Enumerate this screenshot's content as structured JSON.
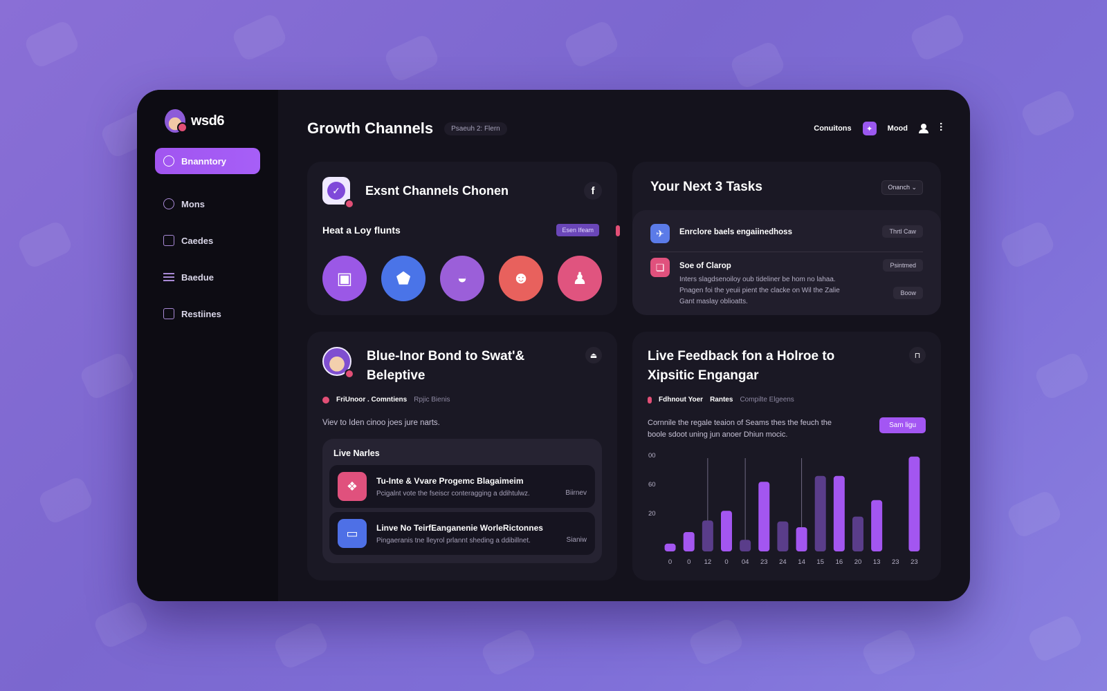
{
  "brand": {
    "name": "wsd6"
  },
  "sidebar": {
    "items": [
      {
        "label": "Bnanntory",
        "active": true
      },
      {
        "label": "Mons",
        "active": false
      },
      {
        "label": "Caedes",
        "active": false
      },
      {
        "label": "Baedue",
        "active": false
      },
      {
        "label": "Restiines",
        "active": false
      }
    ]
  },
  "header": {
    "title": "Growth Channels",
    "pill": "Psaeuh 2: Flern",
    "link1": "Conuitons",
    "link2": "Mood"
  },
  "channels_card": {
    "title": "Exsnt Channels Chonen",
    "subtitle": "Heat a Loy flunts",
    "pill": "Esen Ifeam",
    "channels": [
      {
        "icon": "frame-icon",
        "color": "#9b58e6"
      },
      {
        "icon": "shield-icon",
        "color": "#4a74e8"
      },
      {
        "icon": "hat-icon",
        "color": "#9b5fd9"
      },
      {
        "icon": "face-icon",
        "color": "#e8615d"
      },
      {
        "icon": "bell-icon",
        "color": "#e0547f"
      }
    ]
  },
  "tasks_card": {
    "title": "Your Next 3 Tasks",
    "select_value": "Onanch",
    "tasks": [
      {
        "title": "Enrclore baels engaiinedhoss",
        "pill": "Thrtl Caw",
        "icon_color": "#5b7be8"
      },
      {
        "title": "Soe of Clarop",
        "pill": "Psintmed",
        "pill2": "Boow",
        "icon_color": "#e0517d",
        "desc": [
          "Inters slagdsenoiloy oub tideliner be hom no lahaa.",
          "Pnagen foi the yeuii pient the clacke on Wil the Zalie",
          "Gant maslay oblioatts."
        ]
      }
    ]
  },
  "post_card": {
    "title": "Blue-Inor Bond to Swat'& Beleptive",
    "meta_strong": "FriUnoor . Comntiens",
    "meta_muted": "Rpjic Bienis",
    "body": "Viev to Iden cinoo joes jure narts.",
    "live_title": "Live Narles",
    "items": [
      {
        "title": "Tu-Inte & Vvare Progemc Blagaimeim",
        "desc": "Pcigalnt vote the fseiscr conteragging a ddihtulwz.",
        "side": "Biirnev",
        "icon_color": "#e0517d"
      },
      {
        "title": "Linve No TeirfEanganenie WorleRictonnes",
        "desc": "Pingaeranis tne lleyrol prlannt sheding a ddibillnet.",
        "side": "Sianiw",
        "icon_color": "#4e70e6"
      }
    ]
  },
  "feedback_card": {
    "title": "Live Feedback fon a Holroe to Xipsitic Engangar",
    "meta_strong": "Fdhnout Yoer",
    "meta_strong2": "Rantes",
    "meta_muted": "Compilte Elgeens",
    "body": "Cornnile the regale teaion of Seams thes the feuch the boole sdoot uning jun anoer Dhiun mocic.",
    "cta": "Sam ligu"
  },
  "chart_data": {
    "type": "bar",
    "categories": [
      "0",
      "0",
      "12",
      "0",
      "04",
      "23",
      "24",
      "14",
      "15",
      "16",
      "20",
      "13",
      "23",
      "23"
    ],
    "values": [
      8,
      20,
      32,
      42,
      12,
      72,
      31,
      25,
      78,
      78,
      36,
      53,
      0,
      98
    ],
    "highlight": [
      true,
      true,
      false,
      true,
      false,
      true,
      false,
      true,
      false,
      true,
      false,
      true,
      false,
      true
    ],
    "y_ticks": [
      "00",
      "60",
      "20"
    ],
    "ylim": [
      0,
      100
    ],
    "colors": {
      "bright": "#a356f0",
      "muted": "#5a3d8a"
    }
  }
}
